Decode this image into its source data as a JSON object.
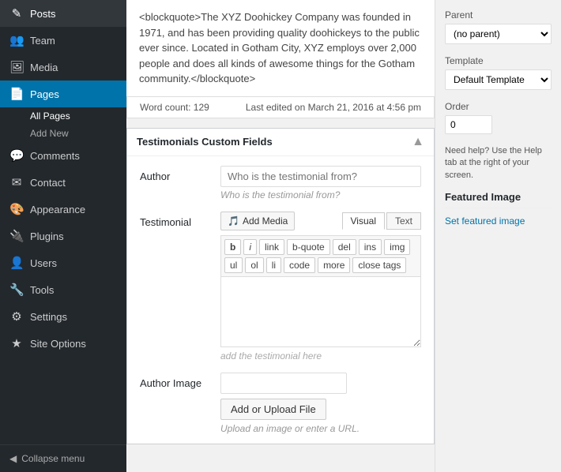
{
  "sidebar": {
    "items": [
      {
        "label": "Posts",
        "icon": "✎",
        "active": false
      },
      {
        "label": "Team",
        "icon": "👥",
        "active": false
      },
      {
        "label": "Media",
        "icon": "🖼",
        "active": false
      },
      {
        "label": "Pages",
        "icon": "📄",
        "active": true
      },
      {
        "label": "Comments",
        "icon": "💬",
        "active": false
      },
      {
        "label": "Contact",
        "icon": "✉",
        "active": false
      },
      {
        "label": "Appearance",
        "icon": "🎨",
        "active": false
      },
      {
        "label": "Plugins",
        "icon": "🔌",
        "active": false
      },
      {
        "label": "Users",
        "icon": "👤",
        "active": false
      },
      {
        "label": "Tools",
        "icon": "🔧",
        "active": false
      },
      {
        "label": "Settings",
        "icon": "⚙",
        "active": false
      },
      {
        "label": "Site Options",
        "icon": "★",
        "active": false
      }
    ],
    "pages_sub": [
      {
        "label": "All Pages",
        "active": true
      },
      {
        "label": "Add New",
        "active": false
      }
    ],
    "collapse_label": "Collapse menu"
  },
  "blockquote_text": "<blockquote>The XYZ Doohickey Company was founded in 1971, and has been providing quality doohickeys to the public ever since. Located in Gotham City, XYZ employs over 2,000 people and does all kinds of awesome things for the Gotham community.</blockquote>",
  "word_count": {
    "label": "Word count: 129",
    "last_edited": "Last edited on March 21, 2016 at 4:56 pm"
  },
  "testimonials_box": {
    "title": "Testimonials Custom Fields",
    "author_label": "Author",
    "author_placeholder": "Who is the testimonial from?",
    "testimonial_label": "Testimonial",
    "add_media_label": "Add Media",
    "visual_tab": "Visual",
    "text_tab": "Text",
    "format_buttons": [
      "b",
      "i",
      "link",
      "b-quote",
      "del",
      "ins",
      "img",
      "ul",
      "ol",
      "li",
      "code",
      "more",
      "close tags"
    ],
    "editor_placeholder": "add the testimonial here",
    "author_image_label": "Author Image",
    "upload_btn_label": "Add or Upload File",
    "upload_hint": "Upload an image or enter a URL."
  },
  "right_panel": {
    "parent_label": "Parent",
    "parent_value": "(no parent)",
    "template_label": "Template",
    "template_value": "Default Template",
    "order_label": "Order",
    "order_value": "0",
    "help_text": "Need help? Use the Help tab at the right of your screen.",
    "featured_image_title": "Featured Image",
    "set_featured_label": "Set featured image"
  }
}
